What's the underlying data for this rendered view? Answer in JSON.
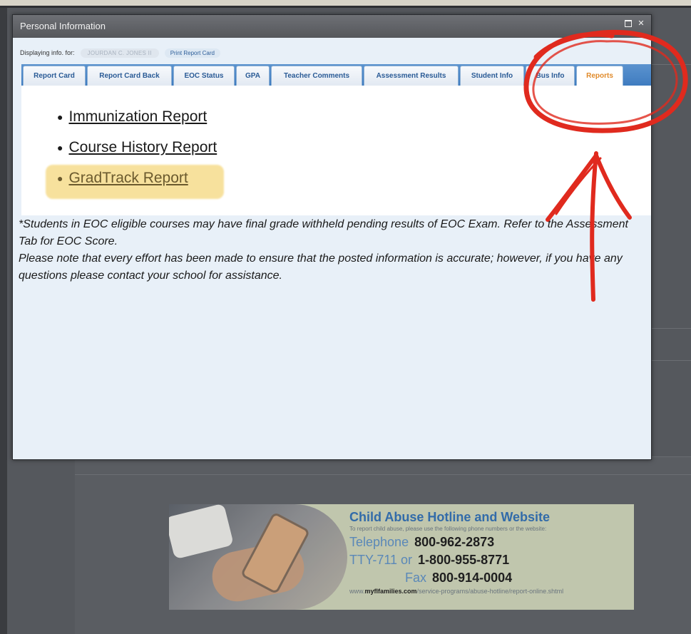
{
  "window": {
    "title": "Personal Information"
  },
  "info_bar": {
    "label": "Displaying info. for:",
    "student_name": "JOURDAN C. JONES II",
    "print_link": "Print Report Card"
  },
  "tabs": [
    {
      "label": "Report Card"
    },
    {
      "label": "Report Card Back"
    },
    {
      "label": "EOC Status"
    },
    {
      "label": "GPA"
    },
    {
      "label": "Teacher Comments"
    },
    {
      "label": "Assessment Results"
    },
    {
      "label": "Student Info"
    },
    {
      "label": "Bus Info"
    },
    {
      "label": "Reports",
      "active": true
    }
  ],
  "reports": [
    {
      "label": "Immunization Report"
    },
    {
      "label": "Course History Report"
    },
    {
      "label": "GradTrack Report",
      "highlighted": true
    }
  ],
  "notes": {
    "eoc": "*Students in EOC eligible courses may have final grade withheld pending results of EOC Exam. Refer to the Assessment Tab for EOC Score.",
    "disclaimer": "Please note that every effort has been made to ensure that the posted information is accurate; however, if you have any questions please contact your school for assistance."
  },
  "banner": {
    "title": "Child Abuse Hotline and Website",
    "subtitle": "To report child abuse, please use the following phone numbers or the website:",
    "telephone_label": "Telephone",
    "telephone_number": "800-962-2873",
    "tty_label": "TTY-711 or",
    "tty_number": "1-800-955-8771",
    "fax_label": "Fax",
    "fax_number": "800-914-0004",
    "url_prefix": "www.",
    "url_domain": "myflfamilies.com",
    "url_path": "/service-programs/abuse-hotline/report-online.shtml"
  },
  "colors": {
    "tab_bar": "#3f7cc0",
    "active_tab_text": "#e08a2a",
    "highlight": "#f6dc8d",
    "annotation": "#e02a1e"
  },
  "icons": {
    "restore": "restore-icon",
    "close": "close-icon"
  }
}
